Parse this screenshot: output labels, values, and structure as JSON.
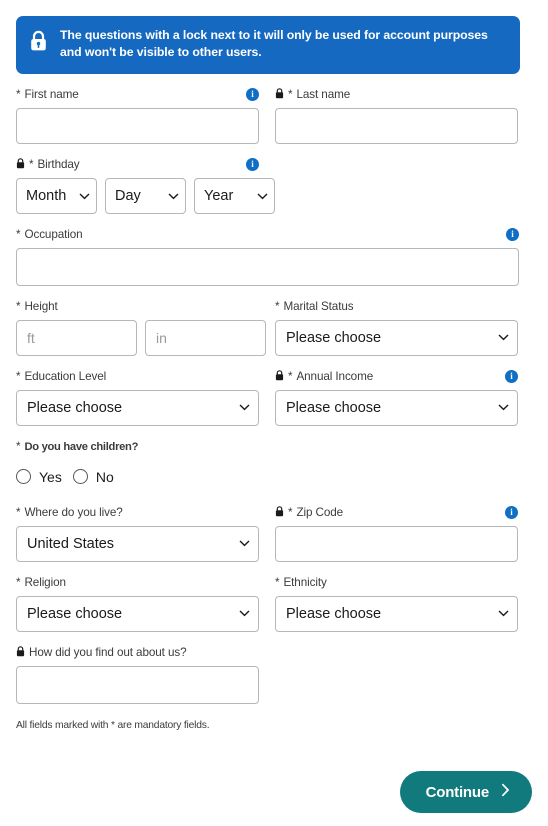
{
  "notice": {
    "icon": "lock-icon",
    "text": "The questions with a lock next to it will only be used for account purposes and won't be visible to other users."
  },
  "colors": {
    "notice_bg": "#1569c0",
    "accent_button": "#107a7d",
    "info_icon": "#0f6fc5",
    "field_border": "#b7b7b7"
  },
  "fields": {
    "first_name": {
      "label": "First name",
      "required_mark": "*",
      "value": "",
      "placeholder": ""
    },
    "last_name": {
      "label": "Last name",
      "required_mark": "*",
      "value": "",
      "placeholder": ""
    },
    "birthday": {
      "label": "Birthday",
      "required_mark": "*",
      "month": "Month",
      "day": "Day",
      "year": "Year"
    },
    "occupation": {
      "label": "Occupation",
      "required_mark": "*",
      "value": "",
      "placeholder": ""
    },
    "height": {
      "label": "Height",
      "required_mark": "*",
      "feet_placeholder": "ft",
      "inches_placeholder": "in",
      "feet_value": "",
      "inches_value": ""
    },
    "marital_status": {
      "label": "Marital Status",
      "required_mark": "*",
      "value": "Please choose"
    },
    "education_level": {
      "label": "Education Level",
      "required_mark": "*",
      "value": "Please choose"
    },
    "annual_income": {
      "label": "Annual Income",
      "required_mark": "*",
      "value": "Please choose"
    },
    "children": {
      "label": "Do you have children?",
      "required_mark": "*",
      "options": [
        {
          "label": "Yes",
          "selected": false
        },
        {
          "label": "No",
          "selected": false
        }
      ]
    },
    "where_do_you_live": {
      "label": "Where do you live?",
      "required_mark": "*",
      "value": "United States"
    },
    "zip_code": {
      "label": "Zip Code",
      "required_mark": "*",
      "value": "",
      "placeholder": ""
    },
    "religion": {
      "label": "Religion",
      "required_mark": "*",
      "value": "Please choose"
    },
    "ethnicity": {
      "label": "Ethnicity",
      "required_mark": "*",
      "value": "Please choose"
    },
    "how_did_you_find_us": {
      "label": "How did you find out about us?",
      "value": "",
      "placeholder": ""
    }
  },
  "footer": {
    "mandatory_note": "All fields marked with * are mandatory fields.",
    "continue_label": "Continue",
    "continue_icon": "chevron-right-icon"
  }
}
